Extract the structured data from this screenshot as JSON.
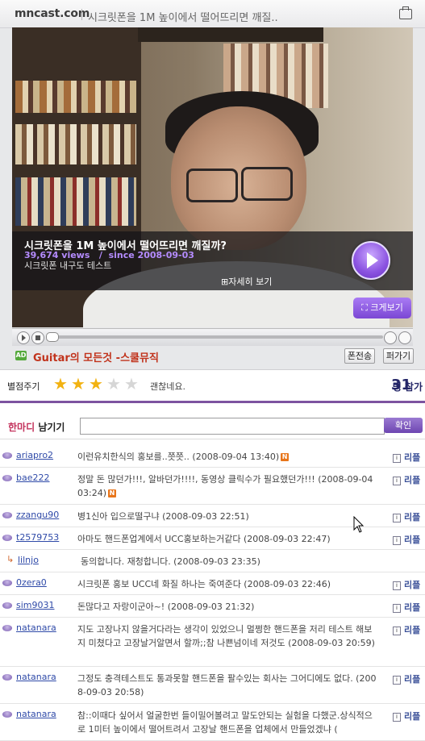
{
  "header": {
    "logo": "mncast.com",
    "title": "시크릿폰을 1M 높이에서 떨어뜨리면 깨질..",
    "icon": "popup-window-icon"
  },
  "video": {
    "title": "시크릿폰을 1M 높이에서 떨어뜨리면 깨질까?",
    "views": "39,674 views",
    "since_sep": "/",
    "since": "since 2008-09-03",
    "subtitle": "시크릿폰 내구도 테스트",
    "detail_link": "자세히 보기",
    "big_view": "크게보기",
    "progress": 0.0
  },
  "ad": {
    "badge": "AD",
    "text": "Guitar의 모든것 -스쿨뮤직",
    "btn_scrap": "폰전송",
    "btn_share": "퍼가기"
  },
  "rating": {
    "label": "별점주기",
    "stars_filled": 3,
    "stars_total": 5,
    "text": "괜찮네요.",
    "count": "31",
    "count_suffix": "명 참가"
  },
  "write": {
    "label_pink": "한마디",
    "label_rest": "남기기",
    "placeholder": "",
    "submit": "확인"
  },
  "reply_label": "리플",
  "comments": [
    {
      "user": "ariapro2",
      "text": "이런유치한식의 홍보를..쯧쯧.. (2008-09-04 13:40)",
      "new": true,
      "lines": 1
    },
    {
      "user": "bae222",
      "text": "정말 돈 많던가!!!, 알바던가!!!!, 동영상 클릭수가 필요했던가!!! (2008-09-04 03:24)",
      "new": true,
      "lines": 2
    },
    {
      "user": "zzangu90",
      "text": "병1신아 입으로떨구냐 (2008-09-03 22:51)",
      "new": false,
      "lines": 1
    },
    {
      "user": "t2579753",
      "text": "아마도 핸드폰업계에서 UCC홍보하는거같다 (2008-09-03 22:47)",
      "new": false,
      "lines": 1
    },
    {
      "user": "lilnjo",
      "text": "동의합니다. 재청합니다. (2008-09-03 23:35)",
      "new": false,
      "lines": 1,
      "reply": true
    },
    {
      "user": "0zera0",
      "text": "시크릿폰 홍보 UCC네 화질 하나는 죽여준다 (2008-09-03 22:46)",
      "new": false,
      "lines": 1
    },
    {
      "user": "sim9031",
      "text": "돈많다고 자랑이군아~! (2008-09-03 21:32)",
      "new": false,
      "lines": 1
    },
    {
      "user": "natanara",
      "text": "지도 고장나지 않을거다라는 생각이 있었으니 멀쩡한 핸드폰을 저리 테스트 해보지 미쳤다고 고장날거알면서 할까;;참 나쁜넘이네 저것도 (2008-09-03 20:59)",
      "new": false,
      "lines": 3
    },
    {
      "user": "natanara",
      "text": "그정도 충격테스트도 통과못할 핸드폰을 팔수있는 회사는 그어디에도 없다. (2008-09-03 20:58)",
      "new": false,
      "lines": 2
    },
    {
      "user": "natanara",
      "text": "참::이때다 싶어서 얼굴한번 들이밀어볼려고 말도안되는 실험을 다했군.상식적으로 1미터 높이에서 떨어트려서 고장날 핸드폰을 업체에서 만들었겠냐 (",
      "new": false,
      "lines": 2
    }
  ]
}
